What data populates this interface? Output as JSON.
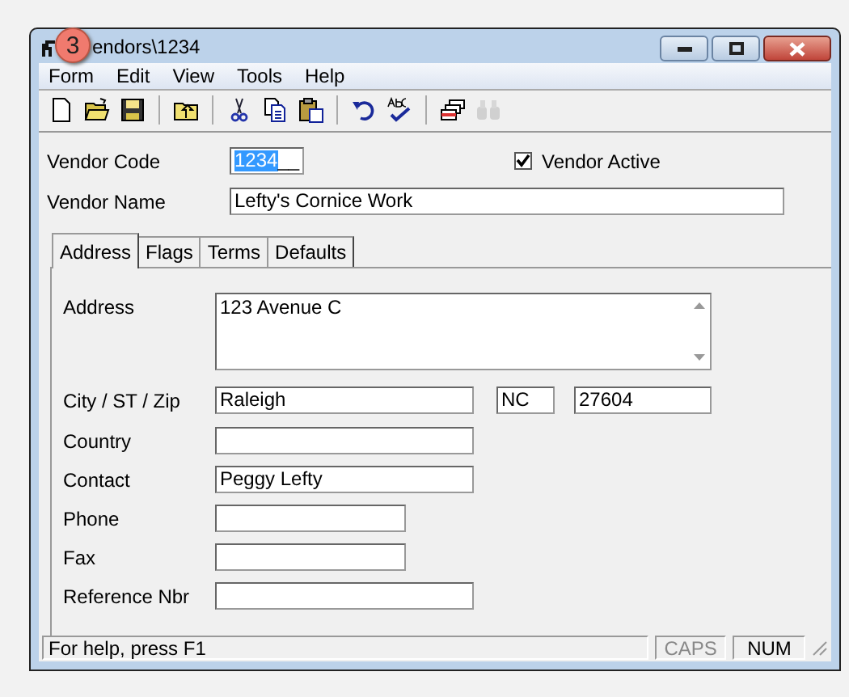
{
  "badge": "3",
  "window": {
    "title": "endors\\1234"
  },
  "menu": [
    "Form",
    "Edit",
    "View",
    "Tools",
    "Help"
  ],
  "toolbar": [
    {
      "kind": "new",
      "disabled": false
    },
    {
      "kind": "open",
      "disabled": false
    },
    {
      "kind": "save",
      "disabled": false
    },
    {
      "kind": "sep"
    },
    {
      "kind": "up",
      "disabled": false
    },
    {
      "kind": "sep"
    },
    {
      "kind": "cut",
      "disabled": false
    },
    {
      "kind": "copy",
      "disabled": false
    },
    {
      "kind": "paste",
      "disabled": false
    },
    {
      "kind": "sep"
    },
    {
      "kind": "undo",
      "disabled": false
    },
    {
      "kind": "spell",
      "disabled": false
    },
    {
      "kind": "sep"
    },
    {
      "kind": "cards",
      "disabled": false
    },
    {
      "kind": "find",
      "disabled": true
    }
  ],
  "vendor_code": {
    "label": "Vendor Code",
    "value": "1234",
    "mask": "__"
  },
  "vendor_active": {
    "label": "Vendor Active",
    "checked": true
  },
  "vendor_name": {
    "label": "Vendor Name",
    "value": "Lefty's Cornice Work"
  },
  "tabs": [
    {
      "label": "Address",
      "selected": true
    },
    {
      "label": "Flags",
      "selected": false
    },
    {
      "label": "Terms",
      "selected": false
    },
    {
      "label": "Defaults",
      "selected": false
    }
  ],
  "address_rows": [
    {
      "label": "Address",
      "kind": "memo",
      "value": "123 Avenue C"
    },
    {
      "label": "City / ST / Zip",
      "kind": "triple",
      "values": [
        "Raleigh",
        "NC",
        "27604"
      ]
    },
    {
      "label": "Country",
      "kind": "long"
    },
    {
      "label": "Contact",
      "kind": "long",
      "value": "Peggy Lefty"
    },
    {
      "label": "Phone",
      "kind": "short"
    },
    {
      "label": "Fax",
      "kind": "short"
    },
    {
      "label": "Reference Nbr",
      "kind": "long"
    }
  ],
  "status_bar": {
    "message": "For help, press F1",
    "indicators": [
      {
        "label": "CAPS",
        "on": false
      },
      {
        "label": "NUM",
        "on": true
      }
    ]
  }
}
